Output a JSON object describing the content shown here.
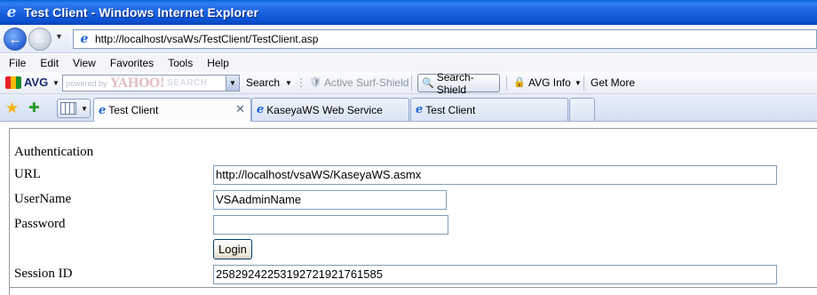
{
  "window": {
    "title": "Test Client - Windows Internet Explorer",
    "app_icon": "ie-icon"
  },
  "address": {
    "url": "http://localhost/vsaWs/TestClient/TestClient.asp"
  },
  "menu": {
    "items": [
      "File",
      "Edit",
      "View",
      "Favorites",
      "Tools",
      "Help"
    ]
  },
  "avg_toolbar": {
    "logo": "AVG",
    "search_placeholder": "powered by",
    "yahoo": "YAHOO!",
    "yahoo_search": "SEARCH",
    "search_label": "Search",
    "active_surf_shield": "Active  Surf-Shield",
    "search_shield": "Search-Shield",
    "avg_info": "AVG Info",
    "get_more": "Get More"
  },
  "tabs": [
    {
      "label": "Test Client",
      "active": true
    },
    {
      "label": "KaseyaWS Web Service",
      "active": false
    },
    {
      "label": "Test Client",
      "active": false
    }
  ],
  "form": {
    "section": "Authentication",
    "url_label": "URL",
    "url_value": "http://localhost/vsaWS/KaseyaWS.asmx",
    "username_label": "UserName",
    "username_value": "VSAadminName",
    "password_label": "Password",
    "password_value": "",
    "login_button": "Login",
    "session_label": "Session ID",
    "session_value": "25829242253192721921761585"
  },
  "colors": {
    "titlebar": "#1d66e3",
    "accent": "#0a44b8"
  }
}
